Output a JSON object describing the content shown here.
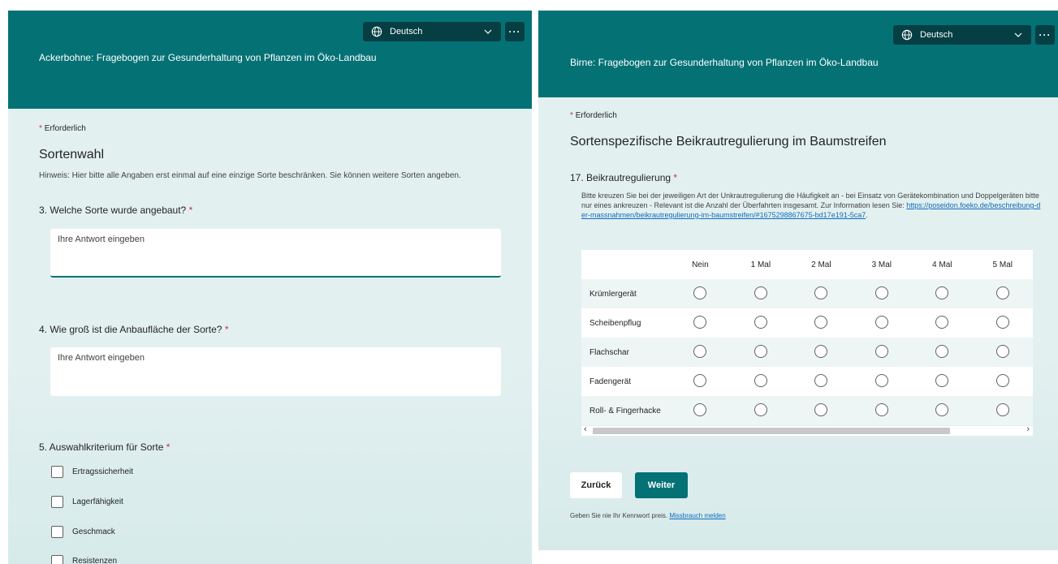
{
  "colors": {
    "header": "#047175",
    "header_control": "#053f44",
    "panel_bg": "#e3f0f0",
    "required_star": "#c4314b",
    "link": "#0f6cbd",
    "primary_button": "#047175"
  },
  "icons": {
    "language": "globe-icon",
    "dropdown": "chevron-down-icon",
    "more": "more-icon",
    "scroll_left": "chevron-left-icon",
    "scroll_right": "chevron-right-icon"
  },
  "left_form": {
    "language": "Deutsch",
    "more_label": "···",
    "title": "Ackerbohne: Fragebogen zur Gesunderhaltung von Pflanzen im Öko-Landbau",
    "required_star": "*",
    "required_label": "Erforderlich",
    "section_title": "Sortenwahl",
    "section_hint": "Hinweis: Hier bitte alle Angaben erst einmal auf eine einzige Sorte beschränken. Sie können weitere Sorten angeben.",
    "questions": [
      {
        "title": "3. Welche Sorte wurde angebaut?",
        "star": "*",
        "placeholder": "Ihre Antwort eingeben"
      },
      {
        "title": "4. Wie groß ist die Anbaufläche der Sorte?",
        "star": "*",
        "placeholder": "Ihre Antwort eingeben"
      },
      {
        "title": "5. Auswahlkriterium für Sorte",
        "star": "*"
      }
    ],
    "options": [
      "Ertragssicherheit",
      "Lagerfähigkeit",
      "Geschmack",
      "Resistenzen"
    ]
  },
  "right_form": {
    "language": "Deutsch",
    "more_label": "···",
    "title": "Birne: Fragebogen zur Gesunderhaltung von Pflanzen im Öko-Landbau",
    "required_star": "*",
    "required_label": "Erforderlich",
    "section_title": "Sortenspezifische Beikrautregulierung im Baumstreifen",
    "question": {
      "title": "17. Beikrautregulierung",
      "star": "*",
      "description": "Bitte kreuzen Sie bei der jeweiligen Art der Unkrautregulierung die Häufigkeit an - bei Einsatz von Gerätekombination und Doppelgeräten bitte nur eines ankreuzen - Relevant ist die Anzahl der Überfahrten insgesamt. Zur Information lesen Sie:",
      "link": "https://poseidon.foeko.de/beschreibung-der-massnahmen/beikrautregulierung-im-baumstreifen/#1675298867675-bd17e191-5ca7",
      "period": "."
    },
    "matrix": {
      "columns": [
        "Nein",
        "1 Mal",
        "2 Mal",
        "3 Mal",
        "4 Mal",
        "5 Mal"
      ],
      "rows": [
        "Krümlergerät",
        "Scheibenpflug",
        "Flachschar",
        "Fadengerät",
        "Roll- & Fingerhacke"
      ]
    },
    "scroll_left": "‹",
    "scroll_right": "›",
    "back_label": "Zurück",
    "next_label": "Weiter",
    "footer_text": "Geben Sie nie Ihr Kennwort preis.",
    "footer_link": "Missbrauch melden"
  }
}
